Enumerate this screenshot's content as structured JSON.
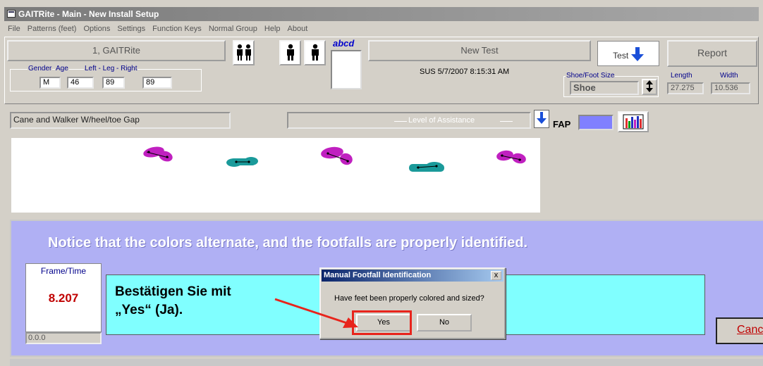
{
  "window": {
    "title": "GAITRite  - Main - New Install Setup"
  },
  "menu": [
    "File",
    "Patterns (feet)",
    "Options",
    "Settings",
    "Function Keys",
    "Normal Group",
    "Help",
    "About"
  ],
  "toolbar": {
    "device_button": "1, GAITRite",
    "new_test_button": "New Test",
    "test_button": "Test",
    "report_button": "Report",
    "abcd_label": "abcd",
    "timestamp": "SUS 5/7/2007 8:15:31 AM"
  },
  "patient": {
    "gender_label": "Gender",
    "gender": "M",
    "age_label": "Age",
    "age": "46",
    "leg_label": "Left - Leg - Right",
    "left_leg": "89",
    "right_leg": "89"
  },
  "shoe": {
    "label": "Shoe/Foot Size",
    "value": "Shoe",
    "length_label": "Length",
    "length": "27.275",
    "width_label": "Width",
    "width": "10.536"
  },
  "test_description": "Cane and Walker W/heel/toe Gap",
  "assistance": {
    "label": "Level of Assistance"
  },
  "fap_label": "FAP",
  "notice": "Notice that the colors alternate, and the footfalls are properly identified.",
  "frame": {
    "title": "Frame/Time",
    "value": "8.207",
    "sub": "0.0.0"
  },
  "callout": {
    "line1": "Bestätigen Sie mit",
    "line2": "„Yes“ (Ja)."
  },
  "cancel_label": "Canc",
  "dialog": {
    "title": "Manual Footfall Identification",
    "message": "Have feet been properly colored and sized?",
    "yes": "Yes",
    "no": "No",
    "close": "x"
  },
  "colors": {
    "left_foot": "#c020c0",
    "right_foot": "#1a9a9a",
    "accent_red": "#e8241c"
  }
}
